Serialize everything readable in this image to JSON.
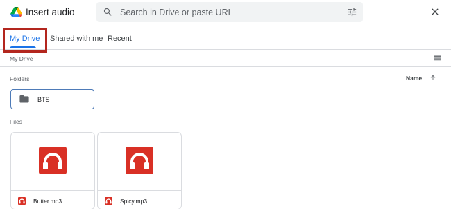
{
  "header": {
    "title": "Insert audio",
    "logo_icon": "google-drive-icon",
    "search": {
      "placeholder": "Search in Drive or paste URL",
      "value": ""
    },
    "icons": {
      "search": "search-icon",
      "filter": "tune-icon",
      "close": "close-icon"
    }
  },
  "tabs": [
    {
      "label": "My Drive",
      "active": true
    },
    {
      "label": "Shared with me",
      "active": false
    },
    {
      "label": "Recent",
      "active": false
    }
  ],
  "breadcrumb": {
    "label": "My Drive"
  },
  "folders_section": {
    "label": "Folders",
    "sort": {
      "label": "Name",
      "direction": "ascending"
    },
    "items": [
      {
        "name": "BTS",
        "icon": "folder-icon"
      }
    ]
  },
  "files_section": {
    "label": "Files",
    "items": [
      {
        "name": "Butter.mp3",
        "icon": "audio-file-icon"
      },
      {
        "name": "Spicy.mp3",
        "icon": "audio-file-icon"
      }
    ]
  },
  "colors": {
    "accent": "#1a73e8",
    "audio_icon": "#d93025",
    "highlight": "#b3261e"
  }
}
